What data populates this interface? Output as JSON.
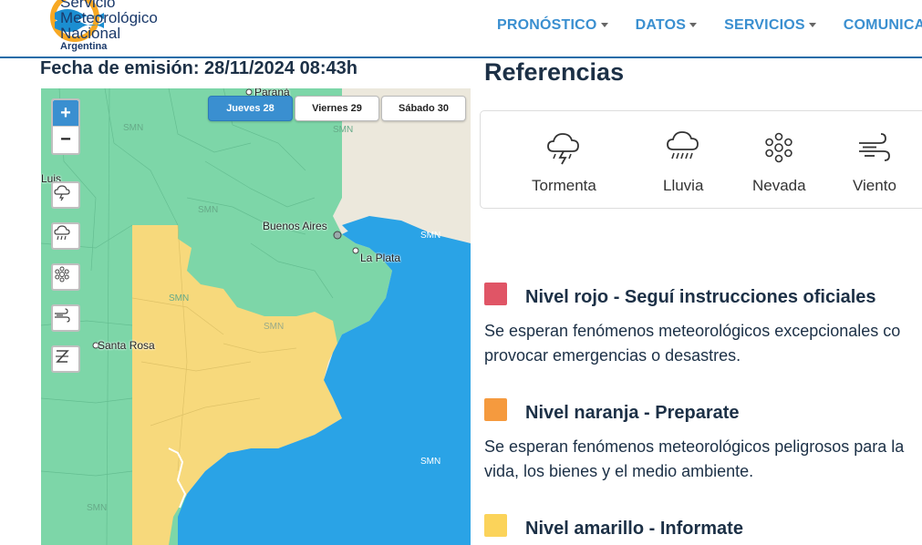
{
  "header": {
    "logo_lines": [
      "Servicio",
      "Meteorológico",
      "Nacional",
      "Argentina"
    ],
    "nav": [
      "PRONÓSTICO",
      "DATOS",
      "SERVICIOS",
      "COMUNICACIÓN"
    ]
  },
  "issue_date": "Fecha de emisión: 28/11/2024 08:43h",
  "map": {
    "zoom_in": "+",
    "zoom_out": "−",
    "day_tabs": [
      "Jueves 28",
      "Viernes 29",
      "Sábado 30"
    ],
    "active_day": "Jueves 28",
    "filters": [
      "storm-filter-icon",
      "rain-filter-icon",
      "snow-filter-icon",
      "wind-filter-icon",
      "zonda-filter-icon"
    ],
    "places": [
      "Paraná",
      "Buenos Aires",
      "La Plata",
      "Santa Rosa",
      "Luis"
    ],
    "watermark": "SMN",
    "colors": {
      "green": "#7dd6a8",
      "yellow": "#f7d97c",
      "sea": "#2aa3e6",
      "land": "#ece8dc"
    }
  },
  "references": {
    "title": "Referencias",
    "items": [
      {
        "label": "Tormenta",
        "icon": "storm-icon"
      },
      {
        "label": "Lluvia",
        "icon": "rain-icon"
      },
      {
        "label": "Nevada",
        "icon": "snow-icon"
      },
      {
        "label": "Viento",
        "icon": "wind-icon"
      }
    ]
  },
  "levels": [
    {
      "title": "Nivel rojo - Seguí instrucciones oficiales",
      "desc": "Se esperan fenómenos meteorológicos excepcionales co provocar emergencias o desastres.",
      "color": "#e05566"
    },
    {
      "title": "Nivel naranja - Preparate",
      "desc": "Se esperan fenómenos meteorológicos peligrosos para la vida, los bienes y el medio ambiente.",
      "color": "#f59a3e"
    },
    {
      "title": "Nivel amarillo - Informate",
      "desc": "",
      "color": "#fbd35a"
    }
  ]
}
